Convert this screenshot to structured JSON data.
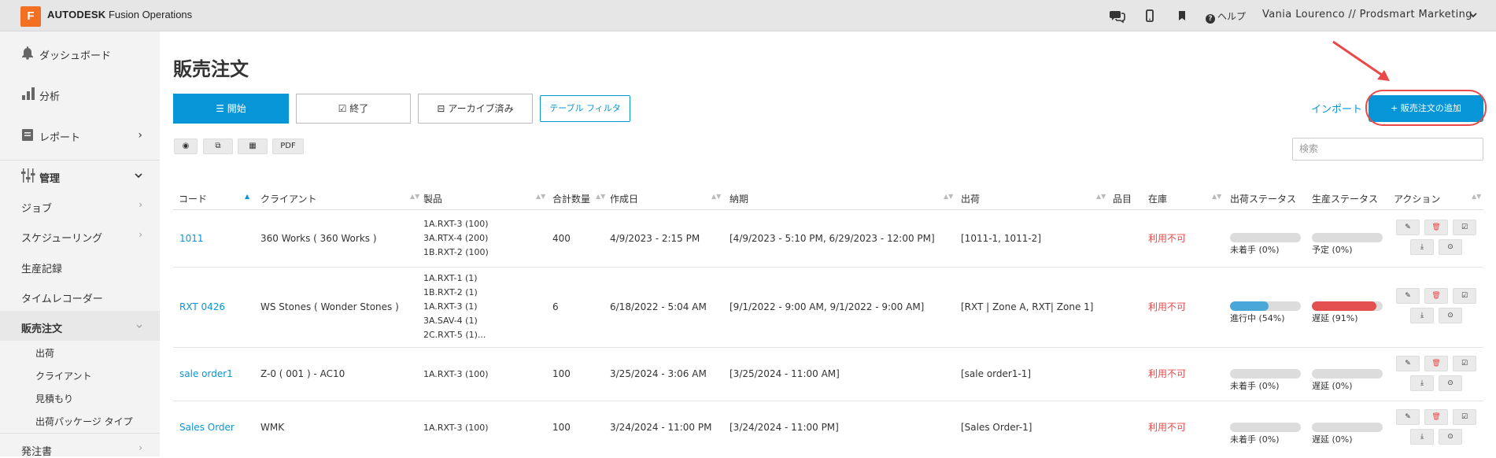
{
  "topbar": {
    "logo_letter": "F",
    "brand": "AUTODESK",
    "product": "Fusion Operations",
    "help_label": "ヘルプ",
    "user": "Vania Lourenco // Prodsmart Marketing"
  },
  "sidebar": {
    "items": [
      {
        "label": "ダッシュボード"
      },
      {
        "label": "分析"
      },
      {
        "label": "レポート"
      },
      {
        "label": "管理"
      },
      {
        "label": "ジョブ"
      },
      {
        "label": "スケジューリング"
      },
      {
        "label": "生産記録"
      },
      {
        "label": "タイムレコーダー"
      },
      {
        "label": "販売注文"
      },
      {
        "label": "発注書"
      }
    ],
    "sub_items": [
      "出荷",
      "クライアント",
      "見積もり",
      "出荷パッケージ タイプ"
    ]
  },
  "main": {
    "title": "販売注文",
    "tabs": [
      "開始",
      "終了",
      "アーカイブ済み"
    ],
    "filter_label": "テーブル フィルタ",
    "pdf_label": "PDF",
    "import_label": "インポート",
    "add_label": "+ 販売注文の追加",
    "search_placeholder": "検索"
  },
  "table": {
    "headers": [
      "コード",
      "クライアント",
      "製品",
      "合計数量",
      "作成日",
      "納期",
      "出荷",
      "品目",
      "在庫",
      "出荷ステータス",
      "生産ステータス",
      "アクション"
    ],
    "rows": [
      {
        "code": "1011",
        "client": "360 Works ( 360 Works )",
        "products": [
          "1A.RXT-3 (100)",
          "3A.RTX-4 (200)",
          "1B.RXT-2 (100)"
        ],
        "qty": "400",
        "created": "4/9/2023 - 2:15 PM",
        "due": "[4/9/2023 - 5:10 PM, 6/29/2023 - 12:00 PM]",
        "shipment": "[1011-1, 1011-2]",
        "stock": "利用不可",
        "ship_status": "未着手 (0%)",
        "ship_pct": 0,
        "prod_status": "予定 (0%)",
        "prod_pct": 0
      },
      {
        "code": "RXT 0426",
        "client": "WS Stones ( Wonder Stones )",
        "products": [
          "1A.RXT-1 (1)",
          "1B.RXT-2 (1)",
          "1A.RXT-3 (1)",
          "3A.SAV-4 (1)",
          "2C.RXT-5 (1)..."
        ],
        "qty": "6",
        "created": "6/18/2022 - 5:04 AM",
        "due": "[9/1/2022 - 9:00 AM, 9/1/2022 - 9:00 AM]",
        "shipment": "[RXT | Zone A, RXT| Zone 1]",
        "stock": "利用不可",
        "ship_status": "進行中 (54%)",
        "ship_pct": 54,
        "prod_status": "遅延 (91%)",
        "prod_pct": 91
      },
      {
        "code": "sale order1",
        "client": "Z-0 ( 001 ) - AC10",
        "products": [
          "1A.RXT-3 (100)"
        ],
        "qty": "100",
        "created": "3/25/2024 - 3:06 AM",
        "due": "[3/25/2024 - 11:00 AM]",
        "shipment": "[sale order1-1]",
        "stock": "利用不可",
        "ship_status": "未着手 (0%)",
        "ship_pct": 0,
        "prod_status": "遅延 (0%)",
        "prod_pct": 0
      },
      {
        "code": "Sales Order",
        "client": "WMK",
        "products": [
          "1A.RXT-3 (100)"
        ],
        "qty": "100",
        "created": "3/24/2024 - 11:00 PM",
        "due": "[3/24/2024 - 11:00 PM]",
        "shipment": "[Sales Order-1]",
        "stock": "利用不可",
        "ship_status": "未着手 (0%)",
        "ship_pct": 0,
        "prod_status": "遅延 (0%)",
        "prod_pct": 0
      }
    ]
  },
  "colors": {
    "accent": "#0696d7",
    "danger": "#e94949",
    "progress_blue": "#4aa8d8",
    "progress_red": "#e34f4f",
    "brand_orange": "#f36f21"
  }
}
